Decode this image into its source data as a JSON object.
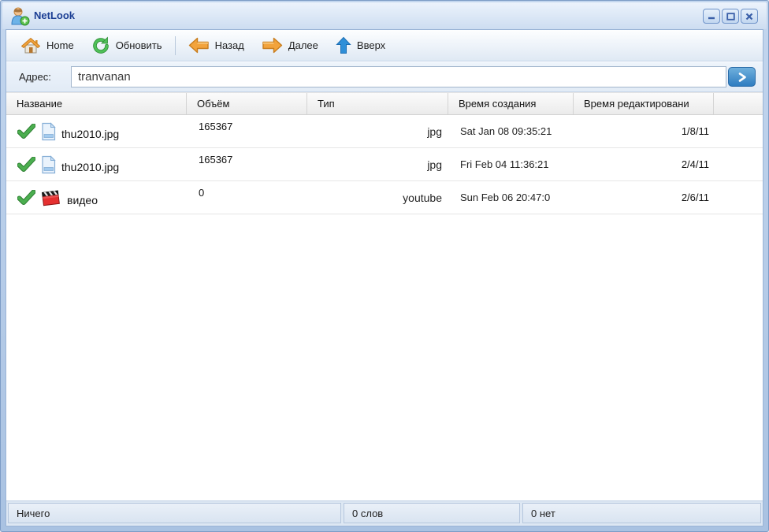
{
  "window": {
    "title": "NetLook",
    "app_icon": "user-with-plus",
    "controls": {
      "minimize_icon": "minimize-dash",
      "maximize_icon": "maximize-square",
      "close_icon": "close-x"
    }
  },
  "toolbar": {
    "home_label": "Home",
    "refresh_label": "Обновить",
    "back_label": "Назад",
    "forward_label": "Далее",
    "up_label": "Вверх",
    "icons": {
      "home": "house",
      "refresh": "green-circular-arrows",
      "back": "orange-arrow-left",
      "forward": "orange-arrow-right",
      "up": "blue-arrow-up"
    }
  },
  "address": {
    "label": "Адрес:",
    "value": "tranvanan",
    "go_icon": "chevron-right"
  },
  "table": {
    "columns": {
      "name": "Название",
      "size": "Объём",
      "type": "Тип",
      "created": "Время создания",
      "edited": "Время редактировани"
    },
    "rows": [
      {
        "status_icon": "green-check",
        "file_icon": "document",
        "name": "thu2010.jpg",
        "size": "165367",
        "type": "jpg",
        "created": "Sat Jan 08 09:35:21",
        "edited": "1/8/11"
      },
      {
        "status_icon": "green-check",
        "file_icon": "document",
        "name": "thu2010.jpg",
        "size": "165367",
        "type": "jpg",
        "created": "Fri Feb 04 11:36:21",
        "edited": "2/4/11"
      },
      {
        "status_icon": "green-check",
        "file_icon": "clapperboard",
        "name": "видео",
        "size": "0",
        "type": "youtube",
        "created": "Sun Feb 06 20:47:0",
        "edited": "2/6/11"
      }
    ]
  },
  "statusbar": {
    "left": "Ничего",
    "middle": "0 слов",
    "right": "0 нет"
  },
  "colors": {
    "frame_blue": "#a9c2e2",
    "titlebar_blue": "#cdddf1",
    "title_text": "#1c3f94",
    "go_button_blue": "#2e7cc0",
    "check_green": "#4bae4f",
    "arrow_orange": "#f2a33c",
    "arrow_blue": "#2f8fd8",
    "refresh_green": "#3fae49",
    "clapper_red": "#e53030"
  }
}
